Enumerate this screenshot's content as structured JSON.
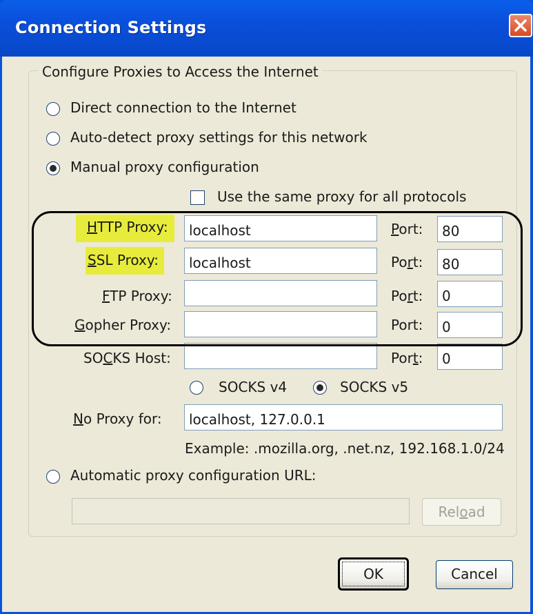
{
  "window": {
    "title": "Connection Settings"
  },
  "group": {
    "legend": "Configure Proxies to Access the Internet"
  },
  "options": {
    "direct": "Direct connection to the Internet",
    "autodetect": "Auto-detect proxy settings for this network",
    "manual": "Manual proxy configuration",
    "autourl": "Automatic proxy configuration URL:"
  },
  "selected_option": "manual",
  "same_proxy": {
    "label": "Use the same proxy for all protocols",
    "checked": false
  },
  "proxies": {
    "http": {
      "key": "H",
      "rest": "TTP Proxy:",
      "host": "localhost",
      "port_pre": "",
      "port_key": "P",
      "port_post": "ort:",
      "port": "80"
    },
    "ssl": {
      "key": "S",
      "rest": "SL Proxy:",
      "host": "localhost",
      "port_pre": "Po",
      "port_key": "r",
      "port_post": "t:",
      "port": "80"
    },
    "ftp": {
      "key": "F",
      "rest": "TP Proxy:",
      "host": "",
      "port_pre": "Po",
      "port_key": "r",
      "port_post": "t:",
      "port": "0"
    },
    "gopher": {
      "key": "G",
      "rest": "opher Proxy:",
      "host": "",
      "port_pre": "",
      "port_key": "",
      "port_post": "Port:",
      "port": "0"
    },
    "socks": {
      "pre": "SO",
      "key": "C",
      "rest": "KS Host:",
      "host": "",
      "port_pre": "Por",
      "port_key": "t",
      "port_post": ":",
      "port": "0"
    }
  },
  "socks_versions": {
    "v4": "SOCKS v4",
    "v5": "SOCKS v5",
    "selected": "v5"
  },
  "no_proxy": {
    "key": "N",
    "rest": "o Proxy for:",
    "value": "localhost, 127.0.0.1",
    "example": "Example: .mozilla.org, .net.nz, 192.168.1.0/24"
  },
  "autourl": {
    "value": "",
    "reload_pre": "Rel",
    "reload_key": "o",
    "reload_post": "ad"
  },
  "buttons": {
    "ok": "OK",
    "cancel": "Cancel"
  },
  "colors": {
    "highlight": "#e7ec3c",
    "titlebar": "#0a53d8",
    "dialog_bg": "#ece9d8"
  }
}
